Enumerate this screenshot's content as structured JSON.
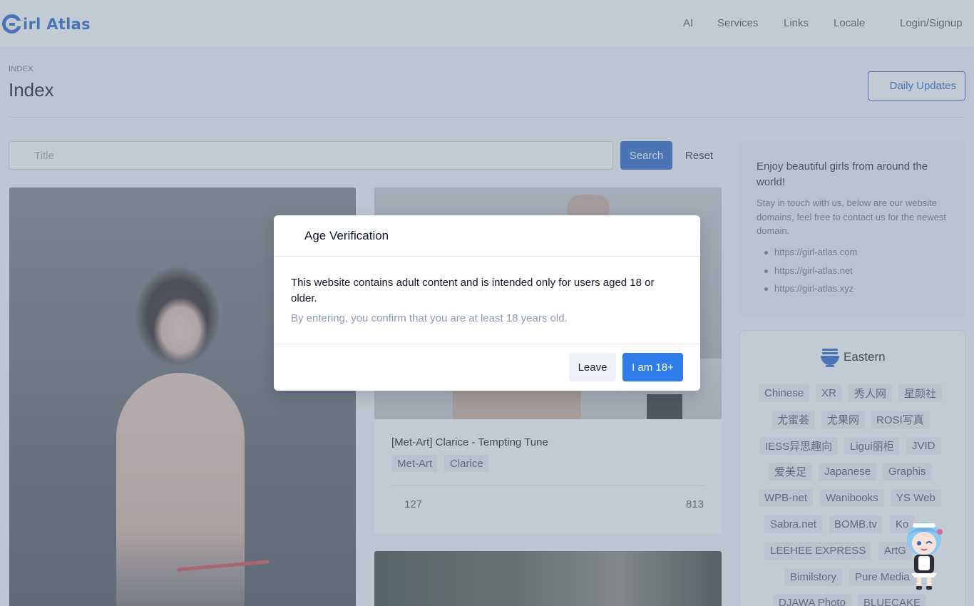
{
  "header": {
    "logo_text": "irl Atlas",
    "nav": [
      "AI",
      "Services",
      "Links",
      "Locale",
      "Login/Signup"
    ]
  },
  "page": {
    "breadcrumb": "INDEX",
    "title": "Index",
    "daily_updates": "Daily Updates"
  },
  "search": {
    "placeholder": "Title",
    "search_label": "Search",
    "reset_label": "Reset"
  },
  "cards": [
    {
      "title": "[Met-Art] Clarice - Tempting Tune",
      "tags": [
        "Met-Art",
        "Clarice"
      ],
      "stat_left": "127",
      "stat_right": "813"
    }
  ],
  "sidebar": {
    "intro_title": "Enjoy beautiful girls from around the world!",
    "intro_text": "Stay in touch with us, below are our website domains, feel free to contact us for the newest domain.",
    "domains": [
      "https://girl-atlas.com",
      "https://girl-atlas.net",
      "https://girl-atlas.xyz"
    ],
    "eastern_title": "Eastern",
    "eastern_tags": [
      "Chinese",
      "XR",
      "秀人网",
      "星颜社",
      "尤蜜荟",
      "尤果网",
      "ROSI写真",
      "IESS异思趣向",
      "Ligui丽柜",
      "JVID",
      "爱美足",
      "Japanese",
      "Graphis",
      "WPB-net",
      "Wanibooks",
      "YS Web",
      "Sabra.net",
      "BOMB.tv",
      "Ko",
      "LEEHEE EXPRESS",
      "ArtG",
      "Bimilstory",
      "Pure Media",
      "DJAWA Photo",
      "BLUECAKE"
    ]
  },
  "modal": {
    "title": "Age Verification",
    "message": "This website contains adult content and is intended only for users aged 18 or older.",
    "sub": "By entering, you confirm that you are at least 18 years old.",
    "leave_label": "Leave",
    "agree_label": "I am 18+"
  },
  "colors": {
    "brand": "#2563c9",
    "agree_button": "#2f7de8",
    "overlay": "#7889a0"
  }
}
